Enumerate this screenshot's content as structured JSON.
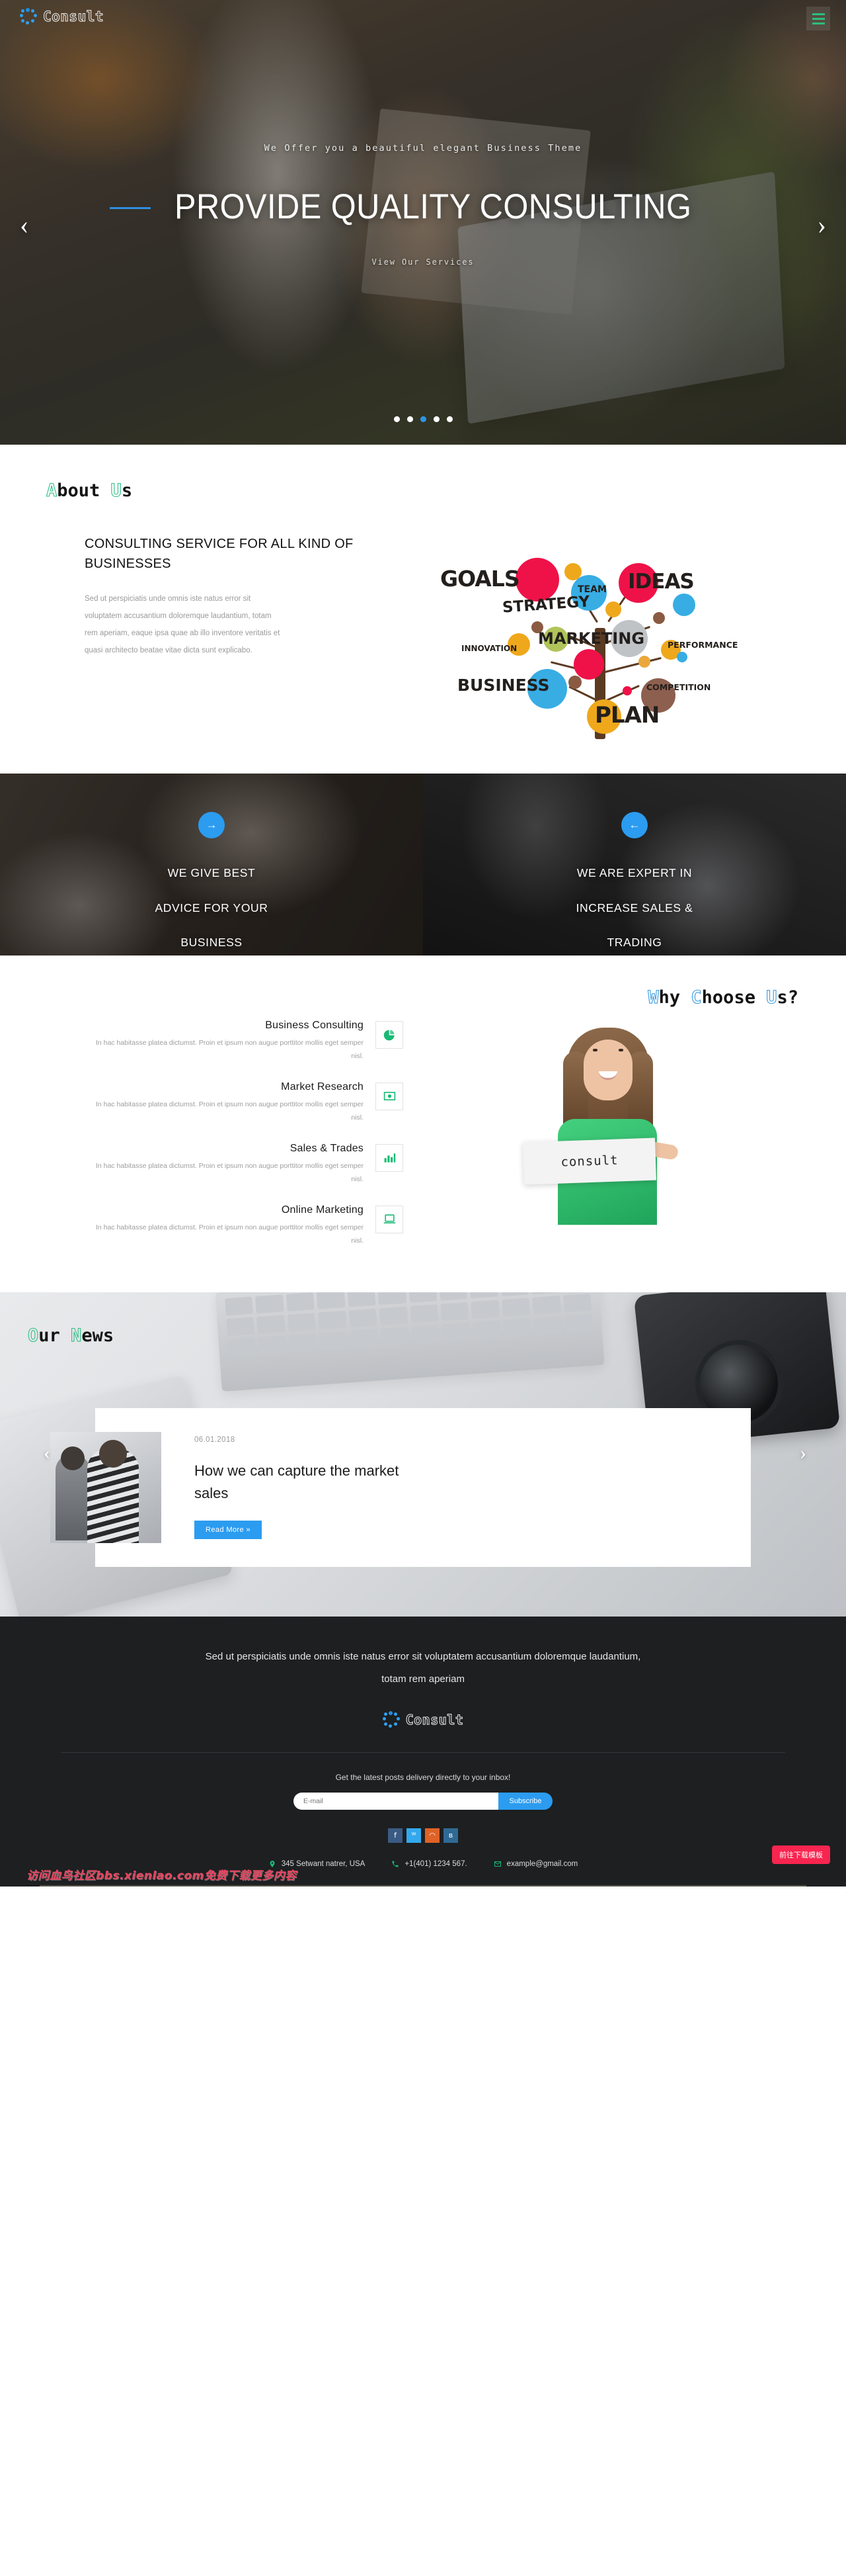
{
  "brand": {
    "name": "Consult"
  },
  "hero": {
    "subtitle": "We Offer you a beautiful elegant Business Theme",
    "title": "PROVIDE QUALITY CONSULTING",
    "cta": "View Our Services",
    "prev_icon": "‹",
    "next_icon": "›",
    "dots": 5,
    "active_dot": 3
  },
  "about": {
    "title_first": "A",
    "title_rest": "bout ",
    "title_second": "U",
    "title_tail": "s",
    "heading": "CONSULTING SERVICE FOR ALL KIND OF BUSINESSES",
    "paragraph": "Sed ut perspiciatis unde omnis iste natus error sit voluptatem accusantium doloremque laudantium, totam rem aperiam, eaque ipsa quae ab illo inventore veritatis et quasi architecto beatae vitae dicta sunt explicabo.",
    "tree_words": [
      "GOALS",
      "STRATEGY",
      "TEAM",
      "IDEAS",
      "MARKETING",
      "INNOVATION",
      "PERFORMANCE",
      "BUSINESS",
      "COMPETITION",
      "PLAN"
    ]
  },
  "panels": [
    {
      "icon": "→",
      "line1": "WE GIVE BEST",
      "line2": "ADVICE FOR YOUR",
      "line3": "BUSINESS"
    },
    {
      "icon": "←",
      "line1": "WE ARE EXPERT IN",
      "line2": "INCREASE SALES &",
      "line3": "TRADING"
    }
  ],
  "why": {
    "title_first": "W",
    "title_rest": "hy ",
    "title_second": "C",
    "title_rest2": "hoose ",
    "title_third": "U",
    "title_tail": "s?",
    "features": [
      {
        "title": "Business Consulting",
        "desc": "In hac habitasse platea dictumst. Proin et ipsum non augue porttitor mollis eget semper nisl.",
        "icon": "pie-chart-icon"
      },
      {
        "title": "Market Research",
        "desc": "In hac habitasse platea dictumst. Proin et ipsum non augue porttitor mollis eget semper nisl.",
        "icon": "money-bill-icon"
      },
      {
        "title": "Sales & Trades",
        "desc": "In hac habitasse platea dictumst. Proin et ipsum non augue porttitor mollis eget semper nisl.",
        "icon": "bar-chart-icon"
      },
      {
        "title": "Online Marketing",
        "desc": "In hac habitasse platea dictumst. Proin et ipsum non augue porttitor mollis eget semper nisl.",
        "icon": "laptop-icon"
      }
    ],
    "sign_text": "consult"
  },
  "news": {
    "title_first": "O",
    "title_rest": "ur ",
    "title_second": "N",
    "title_tail": "ews",
    "date": "06.01.2018",
    "headline": "How we can capture the market sales",
    "read_more": "Read More »",
    "prev_icon": "‹",
    "next_icon": "›"
  },
  "footer": {
    "lead": "Sed ut perspiciatis unde omnis iste natus error sit voluptatem accusantium doloremque laudantium, totam rem aperiam",
    "newsletter_label": "Get the latest posts delivery directly to your inbox!",
    "email_placeholder": "E-mail",
    "email_value": "",
    "subscribe_label": "Subscribe",
    "socials": [
      {
        "name": "facebook",
        "glyph": "f",
        "color": "#3b5b84"
      },
      {
        "name": "twitter",
        "glyph": "ᵂ",
        "color": "#33a9ee"
      },
      {
        "name": "rss",
        "glyph": "◠",
        "color": "#df6227"
      },
      {
        "name": "vk",
        "glyph": "в",
        "color": "#2f6a95"
      }
    ],
    "address": "345 Setwant natrer, USA",
    "phone": "+1(401) 1234 567.",
    "email": "example@gmail.com",
    "watermark": "访问血鸟社区bbs.xienlao.com免费下载更多内容",
    "download_badge": "前往下载模板"
  },
  "colors": {
    "accent_blue": "#2b9cf0",
    "accent_green": "#19b974",
    "footer_bg": "#1d1f21",
    "badge_red": "#f7254f"
  }
}
